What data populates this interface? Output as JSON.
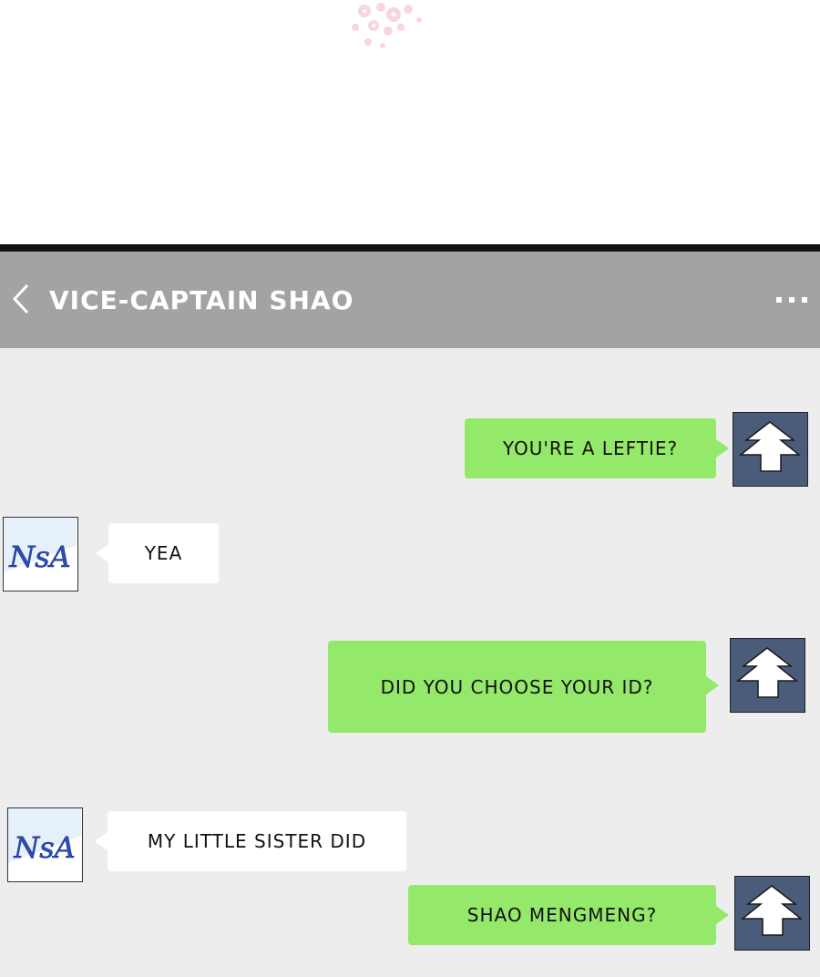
{
  "colors": {
    "header_bg": "#a3a3a3",
    "chat_bg": "#ededed",
    "my_bubble": "#94e86a",
    "their_bubble": "#ffffff",
    "my_avatar_bg": "#4a5c7a",
    "their_avatar_text": "#2a4fb8"
  },
  "header": {
    "title": "VICE-CAPTAIN SHAO",
    "back_icon": "chevron-left-icon",
    "more_icon": "more-dots-icon"
  },
  "avatars": {
    "me": {
      "icon": "tree-avatar-icon"
    },
    "them": {
      "icon": "nsa-avatar-icon",
      "text": "NsA"
    }
  },
  "messages": [
    {
      "sender": "me",
      "text": "YOU'RE A LEFTIE?"
    },
    {
      "sender": "them",
      "text": "YEA"
    },
    {
      "sender": "me",
      "text": "DID YOU CHOOSE YOUR ID?"
    },
    {
      "sender": "them",
      "text": "MY LITTLE SISTER DID"
    },
    {
      "sender": "me",
      "text": "SHAO MENGMENG?"
    }
  ]
}
